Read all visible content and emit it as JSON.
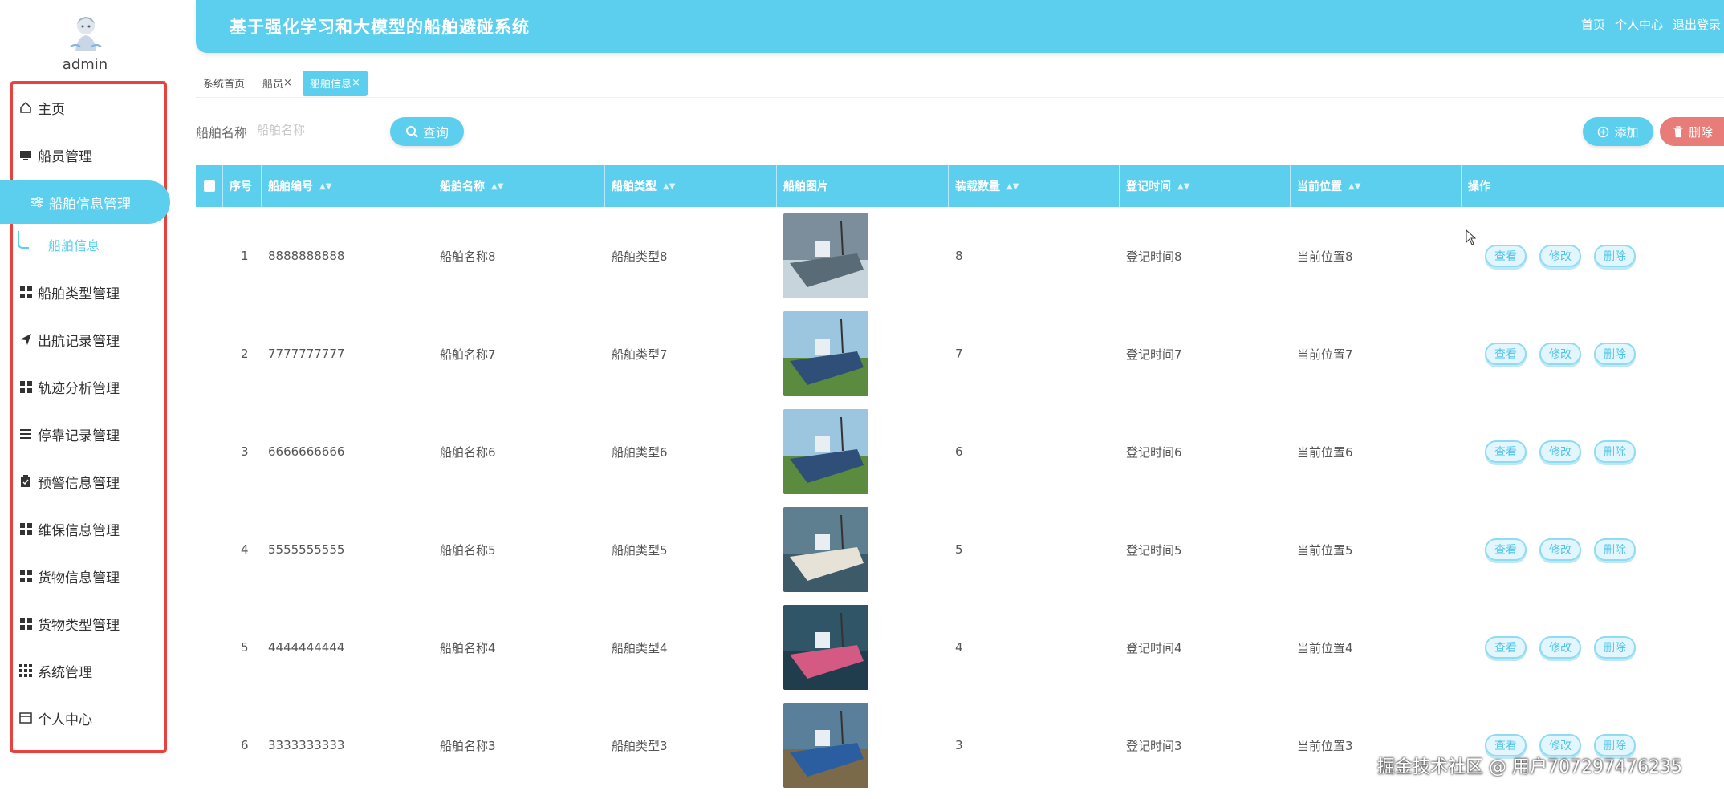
{
  "sidebar": {
    "username": "admin",
    "menu": [
      {
        "label": "主页",
        "icon": "home-icon"
      },
      {
        "label": "船员管理",
        "icon": "monitor-icon"
      },
      {
        "label": "船舶信息管理",
        "icon": "sliders-icon"
      },
      {
        "label": "船舶类型管理",
        "icon": "grid-icon"
      },
      {
        "label": "出航记录管理",
        "icon": "send-icon"
      },
      {
        "label": "轨迹分析管理",
        "icon": "grid-icon"
      },
      {
        "label": "停靠记录管理",
        "icon": "list-icon"
      },
      {
        "label": "预警信息管理",
        "icon": "clipboard-icon"
      },
      {
        "label": "维保信息管理",
        "icon": "grid-icon"
      },
      {
        "label": "货物信息管理",
        "icon": "grid-icon"
      },
      {
        "label": "货物类型管理",
        "icon": "grid-icon"
      },
      {
        "label": "系统管理",
        "icon": "apps-icon"
      },
      {
        "label": "个人中心",
        "icon": "card-icon"
      }
    ],
    "submenu": {
      "label": "船舶信息"
    }
  },
  "header": {
    "title": "基于强化学习和大模型的船舶避碰系统",
    "links": [
      "首页",
      "个人中心",
      "退出登录"
    ]
  },
  "tabs": [
    {
      "label": "系统首页"
    },
    {
      "label": "船员",
      "close": "×"
    },
    {
      "label": "船舶信息",
      "close": "×"
    }
  ],
  "search": {
    "label": "船舶名称",
    "placeholder": "船舶名称",
    "query_label": "查询",
    "add_label": "添加",
    "delete_label": "删除"
  },
  "table": {
    "columns": [
      "序号",
      "船舶编号",
      "船舶名称",
      "船舶类型",
      "船舶图片",
      "装载数量",
      "登记时间",
      "当前位置",
      "操作"
    ],
    "rows": [
      {
        "index": "1",
        "code": "8888888888",
        "name": "船舶名称8",
        "type": "船舶类型8",
        "qty": "8",
        "time": "登记时间8",
        "pos": "当前位置8"
      },
      {
        "index": "2",
        "code": "7777777777",
        "name": "船舶名称7",
        "type": "船舶类型7",
        "qty": "7",
        "time": "登记时间7",
        "pos": "当前位置7"
      },
      {
        "index": "3",
        "code": "6666666666",
        "name": "船舶名称6",
        "type": "船舶类型6",
        "qty": "6",
        "time": "登记时间6",
        "pos": "当前位置6"
      },
      {
        "index": "4",
        "code": "5555555555",
        "name": "船舶名称5",
        "type": "船舶类型5",
        "qty": "5",
        "time": "登记时间5",
        "pos": "当前位置5"
      },
      {
        "index": "5",
        "code": "4444444444",
        "name": "船舶名称4",
        "type": "船舶类型4",
        "qty": "4",
        "time": "登记时间4",
        "pos": "当前位置4"
      },
      {
        "index": "6",
        "code": "3333333333",
        "name": "船舶名称3",
        "type": "船舶类型3",
        "qty": "3",
        "time": "登记时间3",
        "pos": "当前位置3"
      }
    ],
    "actions": [
      "查看",
      "修改",
      "删除"
    ]
  },
  "watermark": "掘金技术社区 @ 用户707297476235",
  "colors": {
    "accent": "#5dcfee",
    "danger": "#e87c78",
    "highlight_border": "#e8423f"
  }
}
